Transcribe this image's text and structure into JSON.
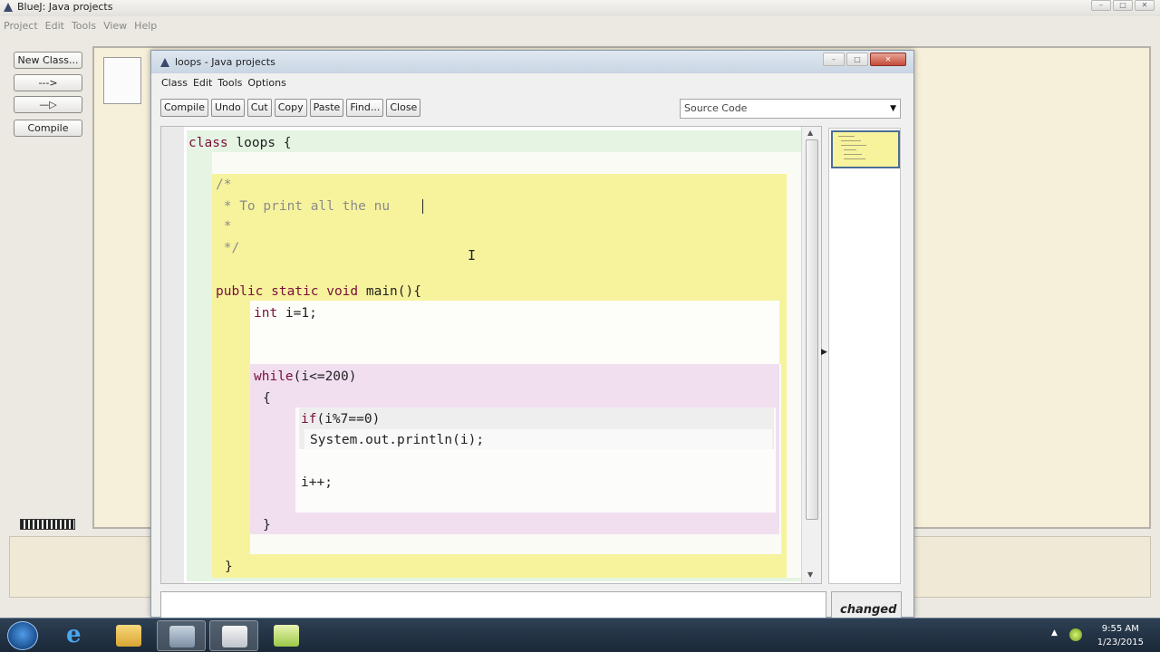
{
  "main_window": {
    "title": "BlueJ: Java projects",
    "menu": [
      "Project",
      "Edit",
      "Tools",
      "View",
      "Help"
    ],
    "side_buttons": {
      "new_class": "New Class...",
      "dashed_arrow": "--->",
      "solid_arrow": "—▷",
      "compile": "Compile"
    }
  },
  "editor": {
    "title": "loops - Java projects",
    "menu": [
      "Class",
      "Edit",
      "Tools",
      "Options"
    ],
    "toolbar": {
      "compile": "Compile",
      "undo": "Undo",
      "cut": "Cut",
      "copy": "Copy",
      "paste": "Paste",
      "find": "Find...",
      "close": "Close"
    },
    "view_select": {
      "value": "Source Code"
    },
    "code": {
      "class_decl_kw": "class",
      "class_decl_rest": " loops {",
      "comment_1": "/*",
      "comment_2": " * To print all the nu",
      "comment_3": " *",
      "comment_4": " */",
      "method_kw": "public static void",
      "method_rest": " main(){",
      "int_kw": "int",
      "int_rest": " i=1;",
      "while_kw": "while",
      "while_rest": "(i<=200)",
      "open_brace": "{",
      "if_kw": "if",
      "if_rest": "(i%7==0)",
      "println": "System.out.println(i);",
      "increment": "i++;",
      "close_while": "}",
      "close_method": "}"
    },
    "status": {
      "message": "",
      "changed": "changed"
    }
  },
  "taskbar": {
    "time": "9:55 AM",
    "date": "1/23/2015"
  },
  "colors": {
    "class_scope": "#e5f4e3",
    "method_scope": "#f7f39d",
    "while_scope": "#f1dff0",
    "keyword": "#7a0f3a",
    "comment": "#8a8a8a"
  }
}
